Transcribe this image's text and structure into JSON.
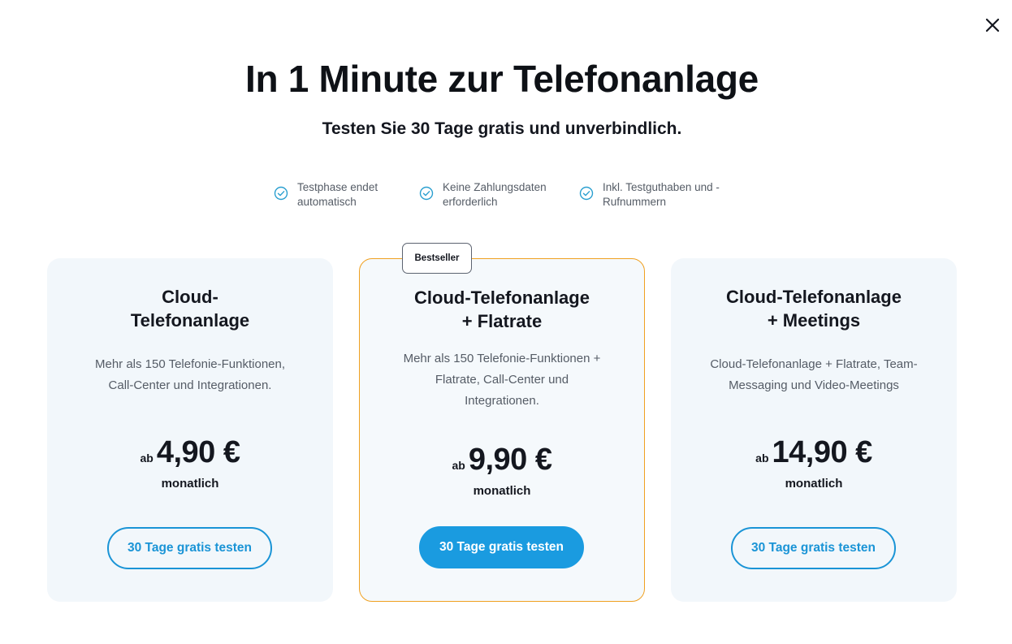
{
  "header": {
    "title": "In 1 Minute zur Telefonanlage",
    "subtitle": "Testen Sie 30 Tage gratis und unverbindlich."
  },
  "close_icon": "close-icon",
  "features": [
    {
      "line1": "Testphase endet",
      "line2": "automatisch",
      "icon": "check-circle-icon"
    },
    {
      "line1": "Keine Zahlungsdaten",
      "line2": "erforderlich",
      "icon": "check-circle-icon"
    },
    {
      "line1": "Inkl. Testguthaben und -",
      "line2": "Rufnummern",
      "icon": "check-circle-icon"
    }
  ],
  "plans": [
    {
      "title_line1": "Cloud-",
      "title_line2": "Telefonanlage",
      "desc_line1": "Mehr als 150 Telefonie-Funktionen,",
      "desc_line2": "Call-Center und Integrationen.",
      "desc_line3": "",
      "price_prefix": "ab",
      "price": "4,90 €",
      "period": "monatlich",
      "cta": "30 Tage gratis testen"
    },
    {
      "badge": "Bestseller",
      "title_line1": "Cloud-Telefonanlage",
      "title_line2": "+ Flatrate",
      "desc_line1": "Mehr als 150 Telefonie-Funktionen +",
      "desc_line2": "Flatrate, Call-Center und",
      "desc_line3": "Integrationen.",
      "price_prefix": "ab",
      "price": "9,90 €",
      "period": "monatlich",
      "cta": "30 Tage gratis testen"
    },
    {
      "title_line1": "Cloud-Telefonanlage",
      "title_line2": "+ Meetings",
      "desc_line1": "Cloud-Telefonanlage + Flatrate, Team-",
      "desc_line2": "Messaging und Video-Meetings",
      "desc_line3": "",
      "price_prefix": "ab",
      "price": "14,90 €",
      "period": "monatlich",
      "cta": "30 Tage gratis testen"
    }
  ],
  "colors": {
    "accent": "#1a9be0",
    "featured_border": "#f0a020",
    "card_bg": "#f2f7fb",
    "check_icon": "#2a9fd0"
  }
}
